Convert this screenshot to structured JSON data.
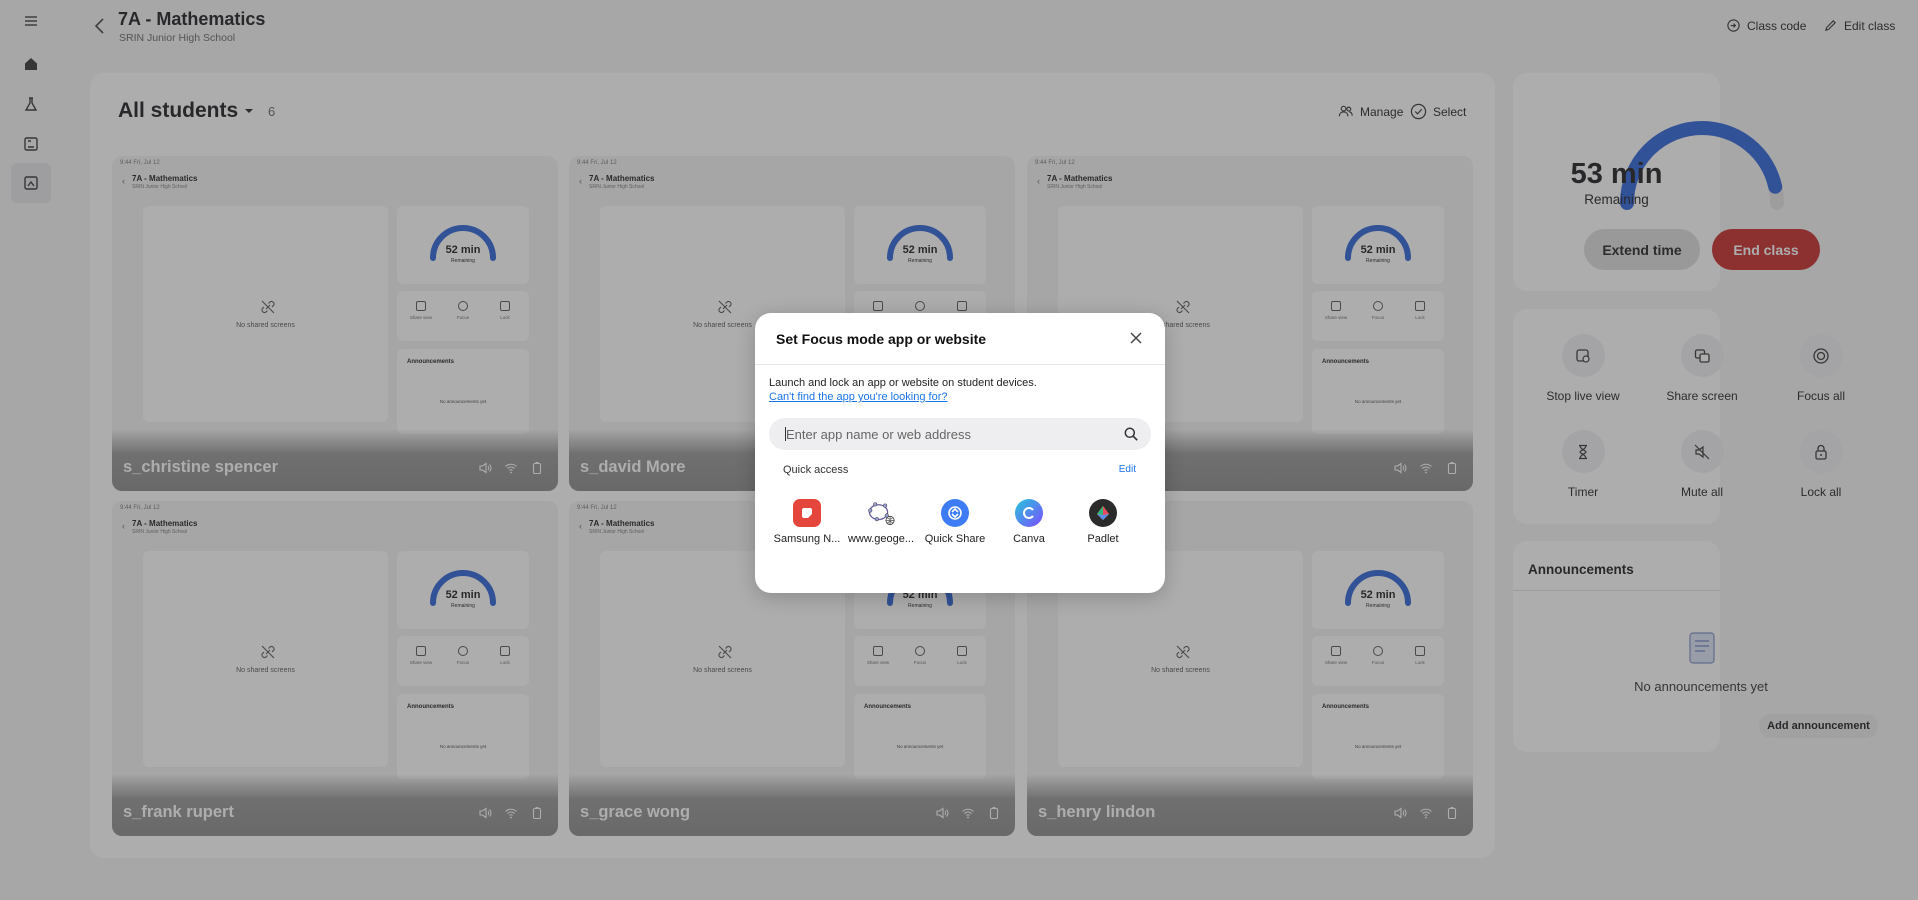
{
  "header": {
    "title": "7A - Mathematics",
    "school": "SRIN Junior High School",
    "class_code_label": "Class code",
    "edit_class_label": "Edit class"
  },
  "panel": {
    "heading": "All students",
    "count": "6",
    "manage_label": "Manage",
    "select_label": "Select"
  },
  "card_template": {
    "mini_title": "7A - Mathematics",
    "mini_sub": "SRIN Junior High School",
    "no_shared": "No shared screens",
    "timer": "52 min",
    "remaining": "Remaining",
    "ctrl1": "Share view",
    "ctrl2": "Focus",
    "ctrl3": "Lock",
    "announcements": "Announcements",
    "no_ann": "No announcements yet",
    "statusbar": "9:44 Fri, Jul 12"
  },
  "students": [
    {
      "name": "s_christine spencer"
    },
    {
      "name": "s_david More"
    },
    {
      "name": "s_frank rupert"
    },
    {
      "name": "s_grace wong"
    },
    {
      "name": "s_henry lindon"
    }
  ],
  "class_timer": {
    "value": "53 min",
    "label": "Remaining",
    "extend_label": "Extend time",
    "end_label": "End class",
    "progress_fraction": 0.93
  },
  "tools": [
    {
      "label": "Stop live view",
      "icon": "stop-live-view-icon"
    },
    {
      "label": "Share screen",
      "icon": "share-screen-icon"
    },
    {
      "label": "Focus all",
      "icon": "focus-icon"
    },
    {
      "label": "Timer",
      "icon": "hourglass-icon"
    },
    {
      "label": "Mute all",
      "icon": "mute-icon"
    },
    {
      "label": "Lock all",
      "icon": "lock-icon"
    }
  ],
  "announcements": {
    "heading": "Announcements",
    "empty": "No announcements yet",
    "add_label": "Add announcement"
  },
  "dialog": {
    "title": "Set Focus mode app or website",
    "description": "Launch and lock an app or website on student devices.",
    "help_link": "Can't find the app you're looking for?",
    "search_placeholder": "Enter app name or web address",
    "quick_access_label": "Quick access",
    "edit_label": "Edit",
    "apps": [
      {
        "label": "Samsung N...",
        "color": "#e5463c",
        "icon": "samsung-notes-icon"
      },
      {
        "label": "www.geoge...",
        "color": "#ffffff",
        "icon": "geogebra-icon"
      },
      {
        "label": "Quick Share",
        "color": "#3d7cf5",
        "icon": "quick-share-icon"
      },
      {
        "label": "Canva",
        "color": "#3ab0e6",
        "icon": "canva-icon"
      },
      {
        "label": "Padlet",
        "color": "#2b2b2b",
        "icon": "padlet-icon"
      }
    ]
  },
  "colors": {
    "accent": "#2b63d9",
    "danger": "#c62828",
    "link": "#1a73e8"
  }
}
